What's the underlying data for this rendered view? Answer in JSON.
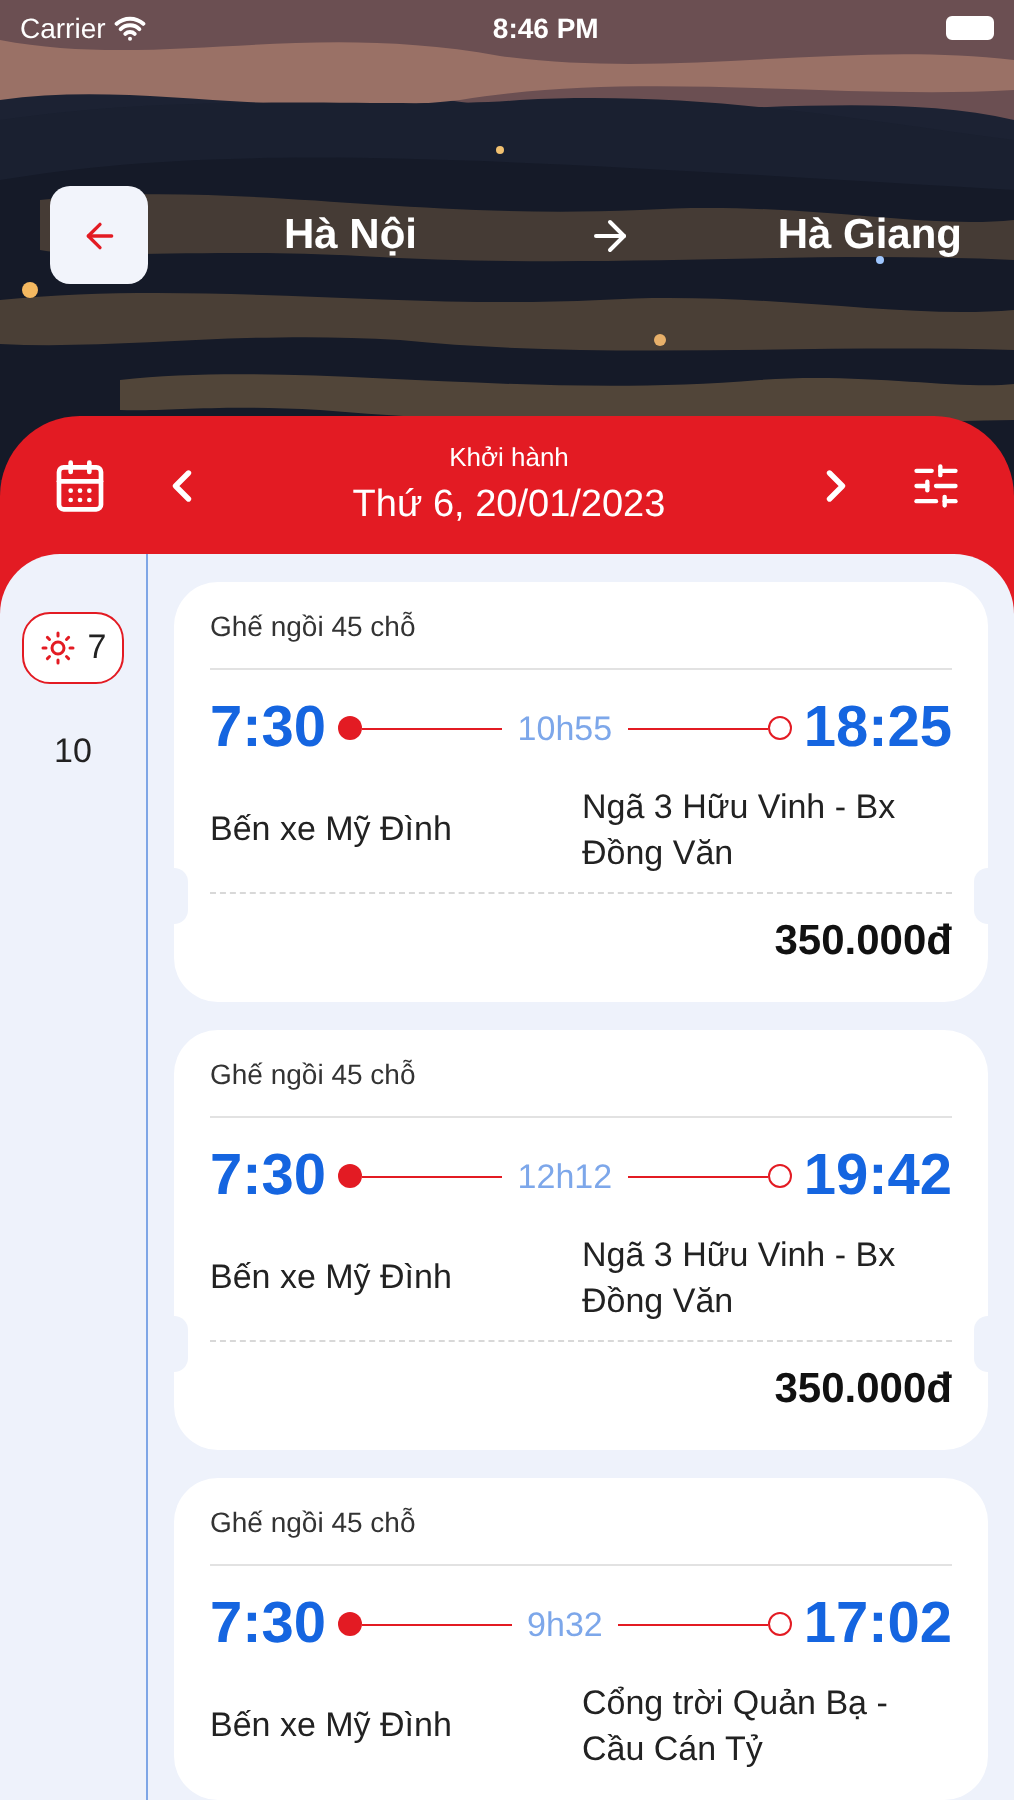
{
  "status_bar": {
    "carrier": "Carrier",
    "time": "8:46 PM"
  },
  "route": {
    "from": "Hà Nội",
    "to": "Hà Giang"
  },
  "date_bar": {
    "label": "Khởi hành",
    "date": "Thứ 6, 20/01/2023"
  },
  "hours": [
    {
      "label": "7",
      "selected": true
    },
    {
      "label": "10",
      "selected": false
    }
  ],
  "trips": [
    {
      "seat_type": "Ghế ngồi 45 chỗ",
      "depart": "7:30",
      "duration": "10h55",
      "arrive": "18:25",
      "from": "Bến xe Mỹ Đình",
      "to": "Ngã 3 Hữu Vinh - Bx Đồng Văn",
      "price": "350.000đ"
    },
    {
      "seat_type": "Ghế ngồi 45 chỗ",
      "depart": "7:30",
      "duration": "12h12",
      "arrive": "19:42",
      "from": "Bến xe Mỹ Đình",
      "to": "Ngã 3 Hữu Vinh - Bx Đồng Văn",
      "price": "350.000đ"
    },
    {
      "seat_type": "Ghế ngồi 45 chỗ",
      "depart": "7:30",
      "duration": "9h32",
      "arrive": "17:02",
      "from": "Bến xe Mỹ Đình",
      "to": "Cổng trời Quản Bạ - Cầu Cán Tỷ"
    }
  ]
}
